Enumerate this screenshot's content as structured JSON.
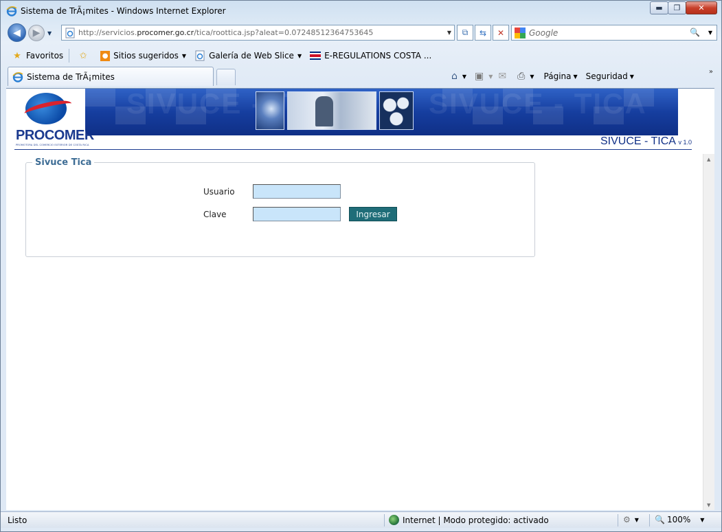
{
  "window": {
    "title": "Sistema de TrÃ¡mites - Windows Internet Explorer",
    "minimize_label": "▬",
    "maximize_label": "❐",
    "close_label": "✕"
  },
  "address_bar": {
    "url_prefix": "http://servicios.",
    "url_domain": "procomer.go.cr",
    "url_suffix": "/tica/roottica.jsp?aleat=0.07248512364753645"
  },
  "search": {
    "placeholder": "Google"
  },
  "favorites_bar": {
    "favorites_label": "Favoritos",
    "items": [
      {
        "label": "Sitios sugeridos",
        "icon": "suggested-sites-icon",
        "has_dropdown": true
      },
      {
        "label": "Galería de Web Slice",
        "icon": "web-slice-icon",
        "has_dropdown": true
      },
      {
        "label": "E-REGULATIONS COSTA ...",
        "icon": "costa-rica-flag-icon",
        "has_dropdown": false
      }
    ]
  },
  "tabs": [
    {
      "label": "Sistema de TrÃ¡mites",
      "active": true
    }
  ],
  "command_bar": {
    "page_label": "Página",
    "security_label": "Seguridad"
  },
  "banner": {
    "logo_text": "PROCOMER",
    "logo_subtext": "PROMOTORA DEL COMERCIO EXTERIOR DE COSTA RICA",
    "watermark": "SIVUCE - TICA",
    "app_title": "SIVUCE - TICA",
    "version": "v 1.0"
  },
  "login": {
    "legend": "Sivuce Tica",
    "username_label": "Usuario",
    "username_value": "",
    "password_label": "Clave",
    "password_value": "",
    "submit_label": "Ingresar"
  },
  "status_bar": {
    "status": "Listo",
    "zone": "Internet | Modo protegido: activado",
    "zoom": "100%"
  },
  "colors": {
    "banner_blue": "#163e9f",
    "logo_red": "#d9232d",
    "legend_text": "#3e6d95",
    "input_bg": "#c9e5fa",
    "button_bg": "#1f6d78"
  }
}
